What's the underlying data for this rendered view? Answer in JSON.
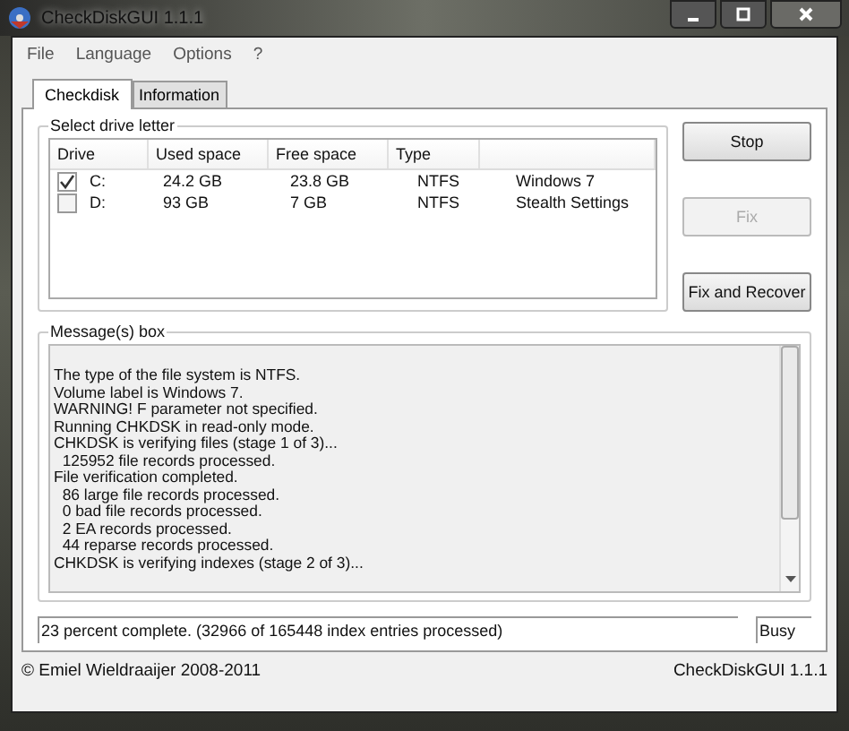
{
  "window": {
    "title": "CheckDiskGUI 1.1.1"
  },
  "menu": [
    "File",
    "Language",
    "Options",
    "?"
  ],
  "tabs": [
    {
      "label": "Checkdisk",
      "selected": true
    },
    {
      "label": "Information",
      "selected": false
    }
  ],
  "drive_group": {
    "title": "Select drive letter",
    "columns": [
      "Drive",
      "Used space",
      "Free space",
      "Type"
    ],
    "rows": [
      {
        "checked": true,
        "drive": "C:",
        "used": "24.2 GB",
        "free": "23.8 GB",
        "type": "NTFS",
        "label": "Windows 7"
      },
      {
        "checked": false,
        "drive": "D:",
        "used": "93 GB",
        "free": "7 GB",
        "type": "NTFS",
        "label": "Stealth Settings"
      }
    ]
  },
  "buttons": [
    {
      "label": "Stop",
      "disabled": false
    },
    {
      "label": "Fix",
      "disabled": true
    },
    {
      "label": "Fix and Recover",
      "disabled": false
    }
  ],
  "messages": {
    "title": "Message(s) box",
    "lines": [
      "The type of the file system is NTFS.",
      "Volume label is Windows 7.",
      "WARNING! F parameter not specified.",
      "Running CHKDSK in read-only mode.",
      "CHKDSK is verifying files (stage 1 of 3)...",
      "  125952 file records processed.",
      "File verification completed.",
      "  86 large file records processed.",
      "  0 bad file records processed.",
      "  2 EA records processed.",
      "  44 reparse records processed.",
      "CHKDSK is verifying indexes (stage 2 of 3)..."
    ]
  },
  "status": {
    "progress": "23 percent complete. (32966 of 165448 index entries processed)",
    "state": "Busy"
  },
  "footer": {
    "copyright": "© Emiel Wieldraaijer 2008-2011",
    "version": "CheckDiskGUI 1.1.1"
  }
}
